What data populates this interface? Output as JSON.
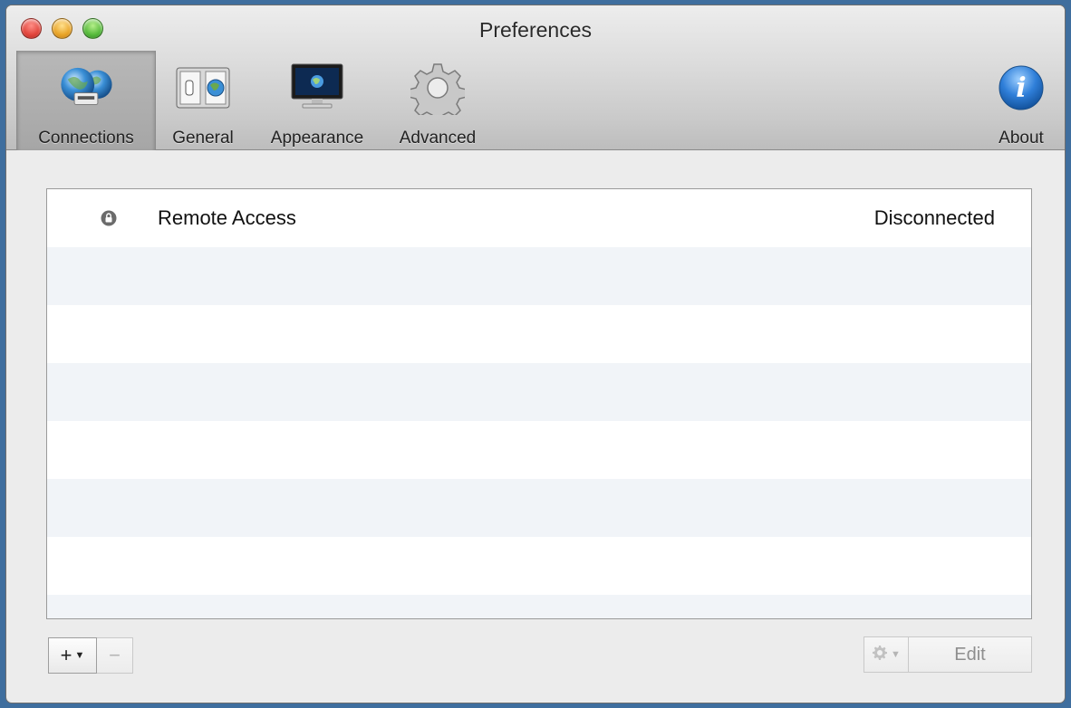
{
  "window": {
    "title": "Preferences"
  },
  "toolbar": {
    "items": [
      {
        "label": "Connections",
        "icon": "connections-globe-icon",
        "selected": true
      },
      {
        "label": "General",
        "icon": "general-switch-icon",
        "selected": false
      },
      {
        "label": "Appearance",
        "icon": "monitor-icon",
        "selected": false
      },
      {
        "label": "Advanced",
        "icon": "gear-icon",
        "selected": false
      }
    ],
    "about": {
      "label": "About",
      "icon": "info-icon"
    }
  },
  "connections": {
    "rows": [
      {
        "name": "Remote Access",
        "status": "Disconnected",
        "icon": "lock-icon"
      }
    ]
  },
  "bottom_bar": {
    "add_label": "+",
    "remove_label": "−",
    "edit_label": "Edit"
  },
  "colors": {
    "row_alt": "#f1f4f8",
    "toolbar_selected": "#a6a6a6",
    "info_blue": "#2f7fd9"
  }
}
